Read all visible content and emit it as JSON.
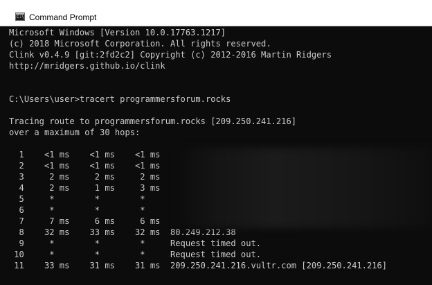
{
  "window": {
    "title": "Command Prompt",
    "icon": "cmd-icon",
    "icon_text": "C:\\"
  },
  "console": {
    "lines": [
      "Microsoft Windows [Version 10.0.17763.1217]",
      "(c) 2018 Microsoft Corporation. All rights reserved.",
      "Clink v0.4.9 [git:2fd2c2] Copyright (c) 2012-2016 Martin Ridgers",
      "http://mridgers.github.io/clink",
      "",
      "",
      "C:\\Users\\user>tracert programmersforum.rocks",
      "",
      "Tracing route to programmersforum.rocks [209.250.241.216]",
      "over a maximum of 30 hops:",
      "",
      "  1    <1 ms    <1 ms    <1 ms",
      "  2    <1 ms    <1 ms    <1 ms",
      "  3     2 ms     2 ms     2 ms",
      "  4     2 ms     1 ms     3 ms",
      "  5     *        *        *",
      "  6     *        *        *",
      "  7     7 ms     6 ms     6 ms",
      "  8    32 ms    33 ms    32 ms  80.249.212.38",
      "  9     *        *        *     Request timed out.",
      " 10     *        *        *     Request timed out.",
      " 11    33 ms    31 ms    31 ms  209.250.241.216.vultr.com [209.250.241.216]"
    ]
  },
  "colors": {
    "console_background": "#0c0c0c",
    "console_text": "#cccccc",
    "titlebar_background": "#ffffff"
  }
}
